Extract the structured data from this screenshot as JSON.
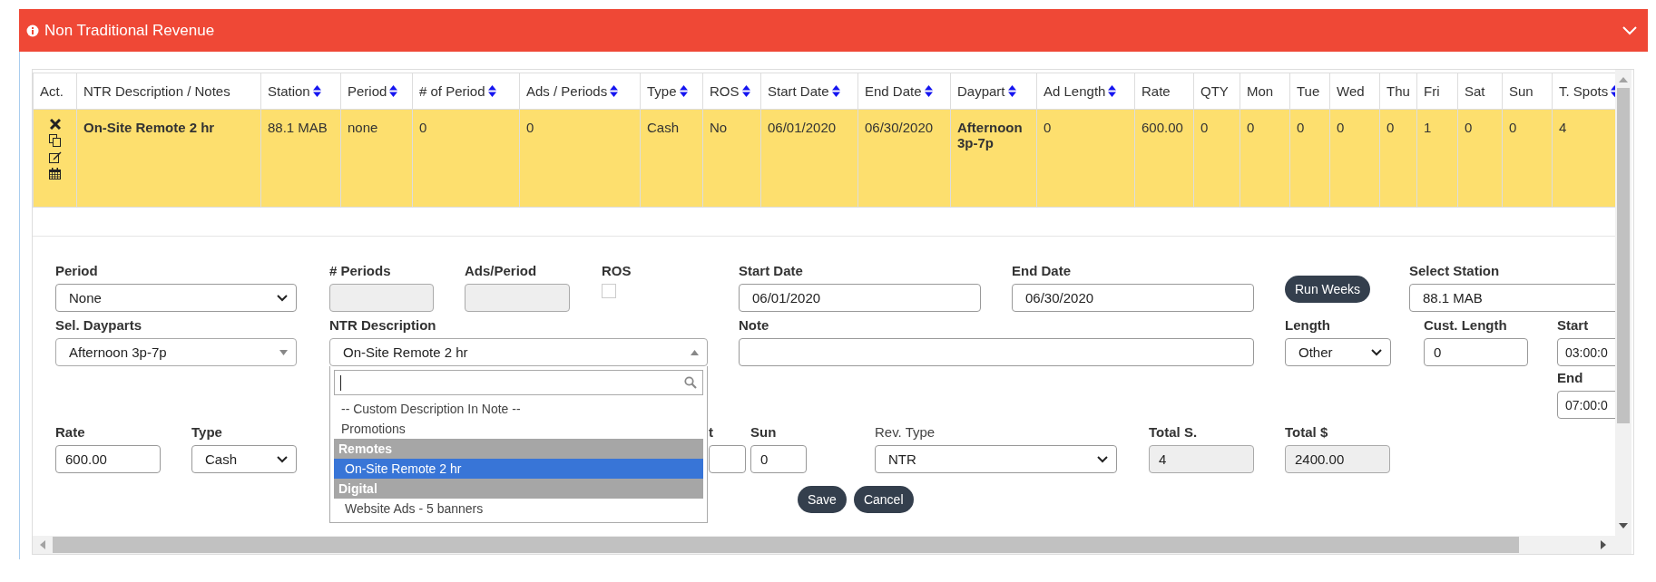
{
  "panel": {
    "title": "Non Traditional Revenue",
    "expanded": true
  },
  "table": {
    "columns": [
      {
        "label": "Act.",
        "kind": "actions",
        "sortable": false
      },
      {
        "label": "NTR Description / Notes",
        "kind": "text",
        "sortable": false
      },
      {
        "label": "Station",
        "kind": "text",
        "sortable": true
      },
      {
        "label": "Period",
        "kind": "text",
        "sortable": true
      },
      {
        "label": "# of Period",
        "kind": "text",
        "sortable": true
      },
      {
        "label": "Ads / Periods",
        "kind": "text",
        "sortable": true
      },
      {
        "label": "Type",
        "kind": "text",
        "sortable": true
      },
      {
        "label": "ROS",
        "kind": "text",
        "sortable": true
      },
      {
        "label": "Start Date",
        "kind": "text",
        "sortable": true
      },
      {
        "label": "End Date",
        "kind": "text",
        "sortable": true
      },
      {
        "label": "Daypart",
        "kind": "text",
        "sortable": true
      },
      {
        "label": "Ad Length",
        "kind": "text",
        "sortable": true
      },
      {
        "label": "Rate",
        "kind": "text",
        "sortable": false
      },
      {
        "label": "QTY",
        "kind": "text",
        "sortable": false
      },
      {
        "label": "Mon",
        "kind": "text",
        "sortable": false
      },
      {
        "label": "Tue",
        "kind": "text",
        "sortable": false
      },
      {
        "label": "Wed",
        "kind": "text",
        "sortable": false
      },
      {
        "label": "Thu",
        "kind": "text",
        "sortable": false
      },
      {
        "label": "Fri",
        "kind": "text",
        "sortable": false
      },
      {
        "label": "Sat",
        "kind": "text",
        "sortable": false
      },
      {
        "label": "Sun",
        "kind": "text",
        "sortable": false
      },
      {
        "label": "T. Spots",
        "kind": "text",
        "sortable": true
      }
    ],
    "rows": [
      {
        "highlighted": true,
        "cells": [
          "",
          {
            "text": "On-Site Remote 2 hr",
            "bold": true
          },
          {
            "text": "88.1 MAB",
            "bold": false
          },
          {
            "text": "none",
            "bold": false
          },
          {
            "text": "0",
            "bold": false
          },
          {
            "text": "0",
            "bold": false
          },
          {
            "text": "Cash",
            "bold": false
          },
          {
            "text": "No",
            "bold": false
          },
          {
            "text": "06/01/2020",
            "bold": false
          },
          {
            "text": "06/30/2020",
            "bold": false
          },
          {
            "text": "Afternoon 3p-7p",
            "bold": true
          },
          {
            "text": "0",
            "bold": false
          },
          {
            "text": "600.00",
            "bold": false
          },
          {
            "text": "0",
            "bold": false
          },
          {
            "text": "0",
            "bold": false
          },
          {
            "text": "0",
            "bold": false
          },
          {
            "text": "0",
            "bold": false
          },
          {
            "text": "0",
            "bold": false
          },
          {
            "text": "1",
            "bold": false
          },
          {
            "text": "0",
            "bold": false
          },
          {
            "text": "0",
            "bold": false
          },
          {
            "text": "4",
            "bold": false
          }
        ]
      }
    ]
  },
  "form": {
    "fields": [
      {
        "kind": "select",
        "label": "Period",
        "label_bold": true,
        "value": "None"
      },
      {
        "kind": "input",
        "label": "# Periods",
        "label_bold": true,
        "disabled": true
      },
      {
        "kind": "input",
        "label": "Ads/Period",
        "label_bold": true,
        "disabled": true
      },
      {
        "kind": "checkbox",
        "label": "ROS",
        "label_bold": true,
        "checked": false
      },
      {
        "kind": "input",
        "label": "Start Date",
        "label_bold": true,
        "value": "06/01/2020",
        "disabled": false
      },
      {
        "kind": "input",
        "label": "End Date",
        "label_bold": true,
        "value": "06/30/2020",
        "disabled": false
      },
      {
        "kind": "button",
        "label": "Run Weeks"
      },
      {
        "kind": "input",
        "label": "Select Station",
        "label_bold": true,
        "value": "88.1 MAB",
        "disabled": false
      },
      {
        "kind": "combo",
        "label": "Sel. Dayparts",
        "label_bold": true,
        "value": "Afternoon 3p-7p",
        "expanded": false
      },
      {
        "kind": "combo",
        "label": "NTR Description",
        "label_bold": true,
        "value": "On-Site Remote 2 hr",
        "expanded": true,
        "options": [
          {
            "kind": "option",
            "label": "-- Custom Description In Note --",
            "selected": false
          },
          {
            "kind": "option",
            "label": "Promotions",
            "selected": false
          },
          {
            "kind": "group",
            "label": "Remotes"
          },
          {
            "kind": "option",
            "label": "On-Site Remote 2 hr",
            "selected": true
          },
          {
            "kind": "group",
            "label": "Digital"
          },
          {
            "kind": "option",
            "label": "Website Ads - 5 banners",
            "selected": false
          }
        ]
      },
      {
        "kind": "input",
        "label": "Note",
        "label_bold": true,
        "disabled": false
      },
      {
        "kind": "select",
        "label": "Length",
        "label_bold": true,
        "value": "Other"
      },
      {
        "kind": "input",
        "label": "Cust. Length",
        "label_bold": true,
        "value": "0",
        "disabled": false
      },
      {
        "kind": "stack",
        "fields": [
          {
            "kind": "input",
            "label": "Start",
            "label_bold": true,
            "value": "03:00:0",
            "disabled": false
          },
          {
            "kind": "input",
            "label": "End",
            "label_bold": true,
            "value": "07:00:0",
            "disabled": false
          }
        ]
      },
      {
        "kind": "input",
        "label": "Rate",
        "label_bold": true,
        "value": "600.00",
        "disabled": false
      },
      {
        "kind": "select",
        "label": "Type",
        "label_bold": true,
        "value": "Cash"
      },
      {
        "kind": "input",
        "label": "t",
        "label_bold": true,
        "disabled": false
      },
      {
        "kind": "input",
        "label": "Sun",
        "label_bold": true,
        "value": "0",
        "disabled": false
      },
      {
        "kind": "select",
        "label": "Rev. Type",
        "label_bold": false,
        "value": "NTR"
      },
      {
        "kind": "input",
        "label": "Total S.",
        "label_bold": true,
        "value": "4",
        "disabled": true
      },
      {
        "kind": "input",
        "label": "Total $",
        "label_bold": true,
        "value": "2400.00",
        "disabled": true
      }
    ],
    "buttons": [
      "Save",
      "Cancel"
    ]
  }
}
